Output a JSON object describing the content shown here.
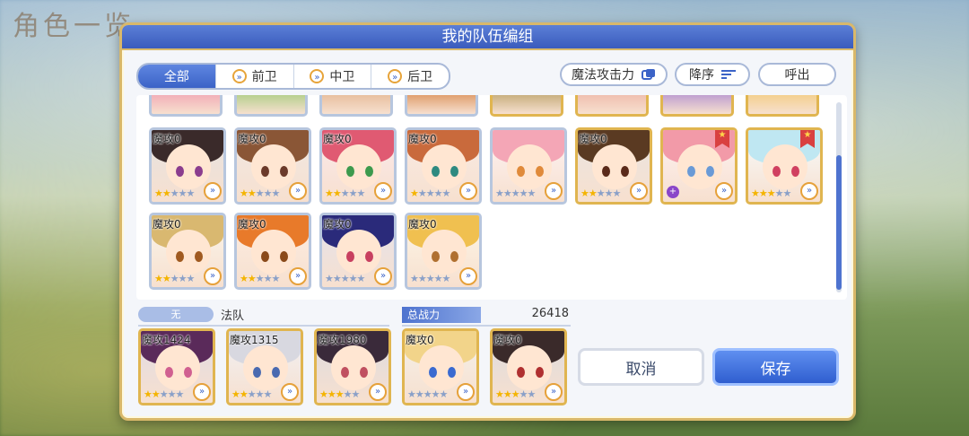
{
  "background": {
    "title": "角色一览"
  },
  "dialog": {
    "title": "我的队伍编组"
  },
  "filters": {
    "tabs": [
      {
        "label": "全部",
        "icon": ""
      },
      {
        "label": "前卫",
        "icon": "chevron-icon"
      },
      {
        "label": "中卫",
        "icon": "chevron-icon"
      },
      {
        "label": "后卫",
        "icon": "chevron-icon"
      }
    ]
  },
  "sort": {
    "criterion": "魔法攻击力",
    "order": "降序",
    "recall": "呼出"
  },
  "roster": {
    "row2": [
      {
        "stat": "魔攻0",
        "stars": 2,
        "frame": "silver",
        "hair": "#3a2a2a",
        "eye": "#8b3d8e"
      },
      {
        "stat": "魔攻0",
        "stars": 2,
        "frame": "silver",
        "hair": "#8a5636",
        "eye": "#6b3a2a"
      },
      {
        "stat": "魔攻0",
        "stars": 2,
        "frame": "silver",
        "hair": "#e05a72",
        "eye": "#3d9a4d"
      },
      {
        "stat": "魔攻0",
        "stars": 1,
        "frame": "silver",
        "hair": "#c96a3c",
        "eye": "#2e8a80"
      },
      {
        "stat": "",
        "stars": 0,
        "frame": "silver",
        "hair": "#f4a6b6",
        "eye": "#e08a3a"
      },
      {
        "stat": "魔攻0",
        "stars": 2,
        "frame": "gold",
        "hair": "#5a3a22",
        "eye": "#5a2a1a"
      },
      {
        "stat": "",
        "stars": 0,
        "frame": "gold",
        "hair": "#f29aa8",
        "eye": "#6a9ad6",
        "ribbon": true,
        "purple": true
      },
      {
        "stat": "",
        "stars": 3,
        "frame": "gold",
        "hair": "#bfe7f2",
        "eye": "#d04060",
        "ribbon": true
      }
    ],
    "row3": [
      {
        "stat": "魔攻0",
        "stars": 2,
        "frame": "silver",
        "hair": "#d9b870",
        "eye": "#a05a20"
      },
      {
        "stat": "魔攻0",
        "stars": 2,
        "frame": "silver",
        "hair": "#e87a2a",
        "eye": "#8a4a1a"
      },
      {
        "stat": "魔攻0",
        "stars": 0,
        "frame": "silver",
        "hair": "#2a2a7a",
        "eye": "#c84060"
      },
      {
        "stat": "魔攻0",
        "stars": 0,
        "frame": "silver",
        "hair": "#f0c050",
        "eye": "#b07030"
      }
    ]
  },
  "team": {
    "role_badge": "无",
    "name": "法队",
    "power_label": "总战力",
    "power_value": "26418",
    "members": [
      {
        "stat": "魔攻1424",
        "stars": 2,
        "hair": "#5a2a5a",
        "eye": "#d06090"
      },
      {
        "stat": "魔攻1315",
        "stars": 2,
        "hair": "#d8d8e0",
        "eye": "#4a6ab0"
      },
      {
        "stat": "魔攻1980",
        "stars": 3,
        "hair": "#3a2a3a",
        "eye": "#c05060"
      },
      {
        "stat": "魔攻0",
        "stars": 0,
        "hair": "#f2d48a",
        "eye": "#3a6ad0"
      },
      {
        "stat": "魔攻0",
        "stars": 3,
        "hair": "#3a2a2a",
        "eye": "#b03030"
      }
    ]
  },
  "buttons": {
    "cancel": "取消",
    "save": "保存"
  }
}
